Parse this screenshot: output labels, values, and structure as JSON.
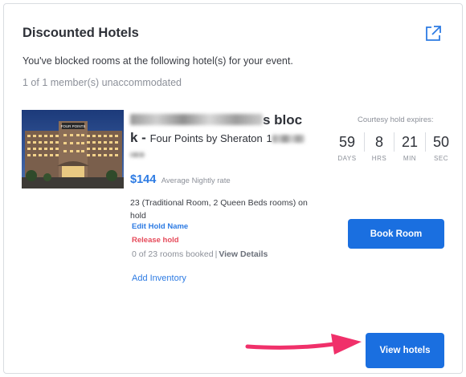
{
  "card": {
    "title": "Discounted Hotels",
    "intro": "You've blocked rooms at the following hotel(s) for your event.",
    "unaccommodated": "1 of 1 member(s) unaccommodated",
    "external_link_icon": "external-link-icon"
  },
  "hotel": {
    "name_line1_visible": "s bloc",
    "name_line2_prefix": "k -",
    "name_sub": "Four Points by Sheraton",
    "name_sub_tail": "1",
    "price": "$144",
    "price_label": "Average Nightly rate",
    "on_hold": "23 (Traditional Room, 2 Queen Beds rooms) on hold",
    "edit_hold": "Edit Hold Name",
    "release_hold": "Release hold",
    "rooms_booked": "0 of 23 rooms booked",
    "view_details": "View Details",
    "add_inventory": "Add Inventory",
    "image_sign": "FOUR POINTS"
  },
  "hold": {
    "label": "Courtesy hold expires:",
    "days": "59",
    "days_label": "DAYS",
    "hrs": "8",
    "hrs_label": "HRS",
    "min": "21",
    "min_label": "MIN",
    "sec": "50",
    "sec_label": "SEC"
  },
  "buttons": {
    "book_room": "Book Room",
    "view_hotels": "View hotels"
  },
  "colors": {
    "primary": "#1a6fe0",
    "link": "#2d7be3",
    "danger": "#e64a5a",
    "annotation_arrow": "#f0306a"
  }
}
